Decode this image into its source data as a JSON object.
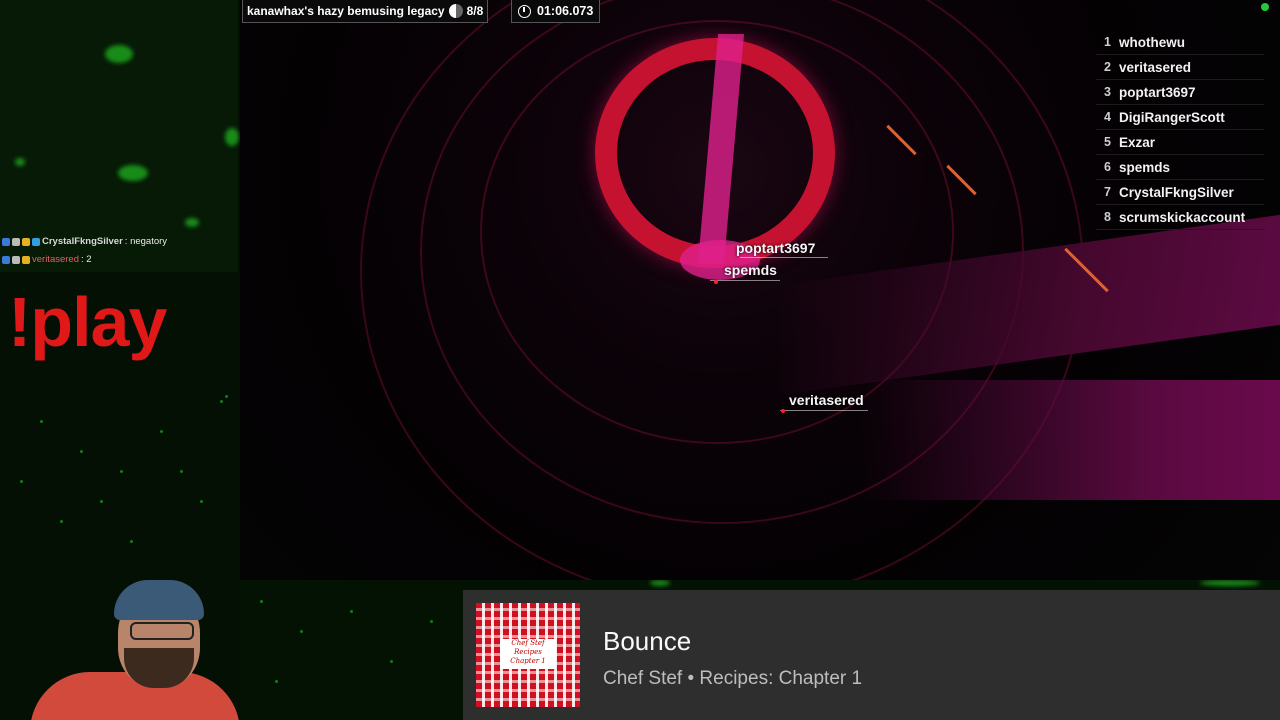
{
  "hud": {
    "level_name": "kanawhax's hazy bemusing legacy",
    "progress": "8/8",
    "timer": "01:06.073"
  },
  "leaderboard": [
    {
      "rank": "1",
      "name": "whothewu"
    },
    {
      "rank": "2",
      "name": "veritasered"
    },
    {
      "rank": "3",
      "name": "poptart3697"
    },
    {
      "rank": "4",
      "name": "DigiRangerScott"
    },
    {
      "rank": "5",
      "name": "Exzar"
    },
    {
      "rank": "6",
      "name": "spemds"
    },
    {
      "rank": "7",
      "name": "CrystalFkngSilver"
    },
    {
      "rank": "8",
      "name": "scrumskickaccount"
    }
  ],
  "players_in_world": [
    {
      "name": "poptart3697"
    },
    {
      "name": "spemds"
    },
    {
      "name": "veritasered"
    }
  ],
  "chat": [
    {
      "user": "CrystalFkngSilver",
      "message": ": negatory"
    },
    {
      "user": "veritasered",
      "message": ": 2"
    }
  ],
  "overlay": {
    "command": "!play"
  },
  "now_playing": {
    "title": "Bounce",
    "subtitle": "Chef Stef • Recipes: Chapter 1"
  },
  "colors": {
    "play_command": "#e01818",
    "ring": "#c41230",
    "particles": "#1fb21f",
    "now_playing_bg": "#2e2e2e"
  }
}
